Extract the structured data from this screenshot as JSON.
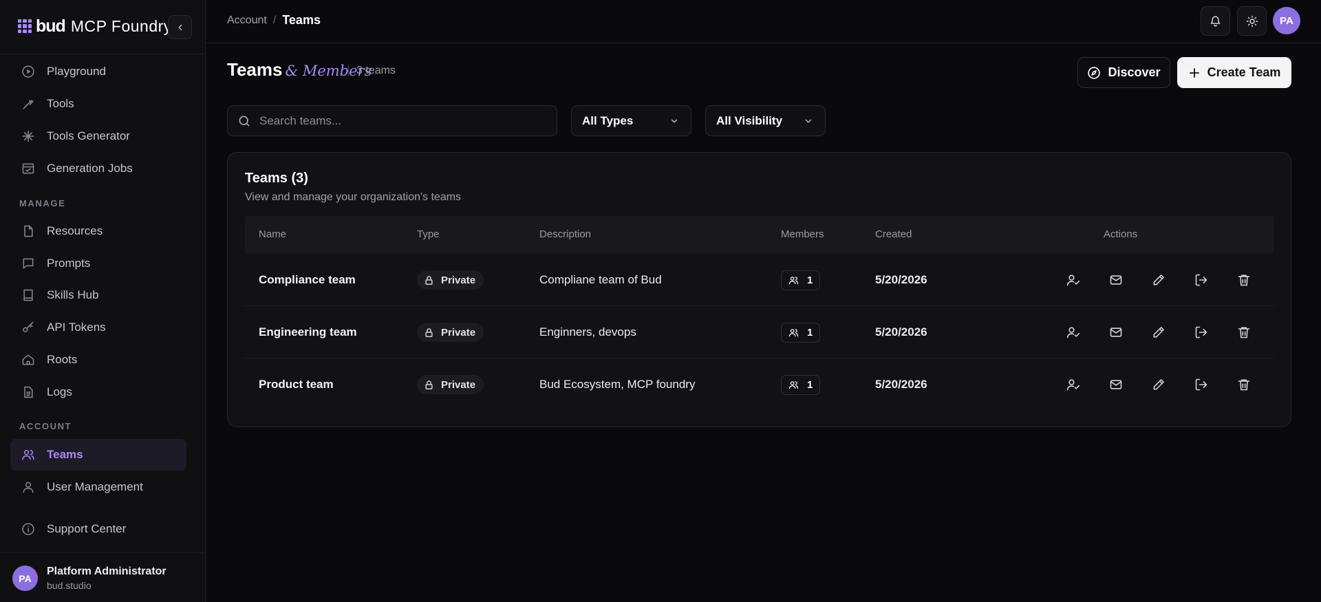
{
  "brand": {
    "name_bold": "bud",
    "name_light": "MCP Foundry"
  },
  "sidebar": {
    "items": [
      {
        "label": "Playground",
        "icon": "play-circle-icon"
      },
      {
        "label": "Tools",
        "icon": "wrench-icon"
      },
      {
        "label": "Tools Generator",
        "icon": "sparkle-icon"
      },
      {
        "label": "Generation Jobs",
        "icon": "calendar-check-icon"
      }
    ],
    "manage_label": "MANAGE",
    "manage_items": [
      {
        "label": "Resources",
        "icon": "file-icon"
      },
      {
        "label": "Prompts",
        "icon": "message-icon"
      },
      {
        "label": "Skills Hub",
        "icon": "book-icon"
      },
      {
        "label": "API Tokens",
        "icon": "key-icon"
      },
      {
        "label": "Roots",
        "icon": "home-icon"
      },
      {
        "label": "Logs",
        "icon": "log-file-icon"
      }
    ],
    "account_label": "ACCOUNT",
    "account_items": [
      {
        "label": "Teams",
        "icon": "users-icon",
        "active": true
      },
      {
        "label": "User Management",
        "icon": "user-icon"
      }
    ],
    "support": {
      "label": "Support Center",
      "icon": "info-icon"
    },
    "user": {
      "initials": "PA",
      "name": "Platform Administrator",
      "org": "bud.studio"
    }
  },
  "breadcrumb": {
    "parent": "Account",
    "separator": "/",
    "current": "Teams"
  },
  "topbar": {
    "avatar_initials": "PA"
  },
  "header": {
    "title": "Teams",
    "title_accent": "& Members",
    "count": "3 teams",
    "discover_label": "Discover",
    "create_label": "Create Team"
  },
  "filters": {
    "search_placeholder": "Search teams...",
    "type_value": "All Types",
    "visibility_value": "All Visibility"
  },
  "table": {
    "title": "Teams (3)",
    "subtitle": "View and manage your organization's teams",
    "columns": [
      "Name",
      "Type",
      "Description",
      "Members",
      "Created",
      "Actions"
    ],
    "rows": [
      {
        "name": "Compliance team",
        "type": "Private",
        "description": "Compliane team of Bud",
        "members": "1",
        "created": "5/20/2026"
      },
      {
        "name": "Engineering team",
        "type": "Private",
        "description": "Enginners, devops",
        "members": "1",
        "created": "5/20/2026"
      },
      {
        "name": "Product team",
        "type": "Private",
        "description": "Bud Ecosystem, MCP foundry",
        "members": "1",
        "created": "5/20/2026"
      }
    ]
  },
  "colors": {
    "accent": "#a78bfa",
    "background": "#0a0a0c",
    "sidebar": "#101013"
  }
}
